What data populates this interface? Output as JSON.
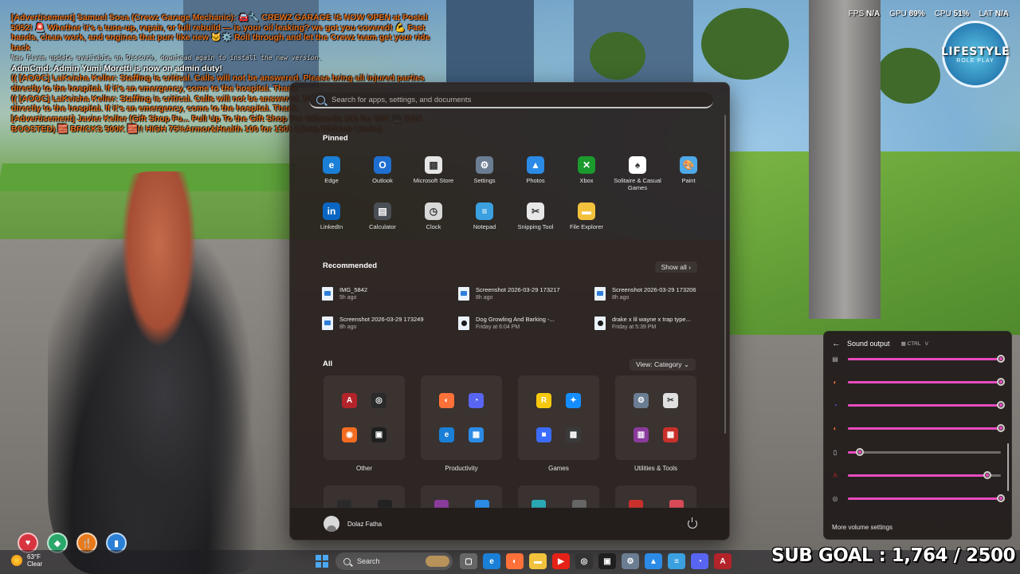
{
  "chat": [
    {
      "cls": "orange",
      "text": "[Advertisement] Samuel Sosa (Crewz Garage Mechanic): 🚘🔧 CREWZ GARAGE IS NOW OPEN at Postal 5052! 🚨 Whether it's a tune-up, repair, or full rebuild — is your oil leaking? we got you covered! 💪 Fast hands, clean work, and engines that purr like new 🐱⚙️ Roll through and let the Crewz team get your ride back"
    },
    {
      "cls": "small",
      "text": "New Fivem update available on Discord, download again to install the new version."
    },
    {
      "cls": "white",
      "text": "AdmCmd: Admin Yumi Moretti is now on admin duty!"
    },
    {
      "cls": "orange",
      "text": "(( [AOOC] LaKeisha Keller: Staffing is critical. Calls will not be answered. Please bring all injured parties directly to the hospital. If it's an emergency, come to the hospital. Thank"
    },
    {
      "cls": "orange",
      "text": "(( [AOOC] LaKeisha Keller: Staffing is critical. Calls will not be answered. Please bring all injured parties directly to the hospital. If it's an emergency, come to the hospital. Thank"
    },
    {
      "cls": "orange",
      "text": "[Advertisement] Javier Keller (Gift Shop Fu... Pull Up To the Gift Shop For Giftcards 100 for 50K 💻 (10X BOOSTED) 🧱 BRICKS 500K 🧱!! HIGH 75%Armor&Health 100 for 150k (Shop Without Limits)"
    }
  ],
  "hud": {
    "fps_label": "FPS",
    "fps_value": "N/A",
    "gpu_label": "GPU",
    "gpu_value": "89%",
    "cpu_label": "CPU",
    "cpu_value": "51%",
    "lat_label": "LAT",
    "lat_value": "N/A"
  },
  "logo": {
    "line1": "LIFESTYLE",
    "line2": "ROLE PLAY"
  },
  "start_menu": {
    "search_placeholder": "Search for apps, settings, and documents",
    "pinned_title": "Pinned",
    "pinned": [
      {
        "name": "edge",
        "label": "Edge",
        "icon": "edge-icon",
        "color": "#1a7fd6",
        "glyph": "e"
      },
      {
        "name": "outlook",
        "label": "Outlook",
        "icon": "outlook-icon",
        "color": "#1f6fd1",
        "glyph": "O"
      },
      {
        "name": "microsoft-store",
        "label": "Microsoft Store",
        "icon": "store-icon",
        "color": "#e6e6e6",
        "glyph": "▦"
      },
      {
        "name": "settings",
        "label": "Settings",
        "icon": "gear-icon",
        "color": "#6b7d92",
        "glyph": "⚙"
      },
      {
        "name": "photos",
        "label": "Photos",
        "icon": "photos-icon",
        "color": "#2b8be6",
        "glyph": "▲"
      },
      {
        "name": "xbox",
        "label": "Xbox",
        "icon": "xbox-icon",
        "color": "#1b9a2e",
        "glyph": "✕"
      },
      {
        "name": "solitaire",
        "label": "Solitaire & Casual Games",
        "icon": "cards-icon",
        "color": "#ffffff",
        "glyph": "♠"
      },
      {
        "name": "paint",
        "label": "Paint",
        "icon": "paint-icon",
        "color": "#4ea9e8",
        "glyph": "🎨"
      },
      {
        "name": "linkedin",
        "label": "LinkedIn",
        "icon": "linkedin-icon",
        "color": "#0a66c2",
        "glyph": "in"
      },
      {
        "name": "calculator",
        "label": "Calculator",
        "icon": "calculator-icon",
        "color": "#4a4e55",
        "glyph": "▤"
      },
      {
        "name": "clock",
        "label": "Clock",
        "icon": "clock-icon",
        "color": "#d8d8d8",
        "glyph": "◷"
      },
      {
        "name": "notepad",
        "label": "Notepad",
        "icon": "notepad-icon",
        "color": "#3aa0e0",
        "glyph": "≡"
      },
      {
        "name": "snipping-tool",
        "label": "Snipping Tool",
        "icon": "scissors-icon",
        "color": "#e8e8e8",
        "glyph": "✂"
      },
      {
        "name": "file-explorer",
        "label": "File Explorer",
        "icon": "folder-icon",
        "color": "#f2c23c",
        "glyph": "▬"
      }
    ],
    "recommended_title": "Recommended",
    "show_all": "Show all",
    "recommended": [
      {
        "title": "IMG_5842",
        "sub": "5h ago",
        "type": "img"
      },
      {
        "title": "Screenshot 2026-03-29 173217",
        "sub": "8h ago",
        "type": "img"
      },
      {
        "title": "Screenshot 2026-03-29 173206",
        "sub": "8h ago",
        "type": "img"
      },
      {
        "title": "Screenshot 2026-03-29 173249",
        "sub": "8h ago",
        "type": "img"
      },
      {
        "title": "Dog Growling And Barking -...",
        "sub": "Friday at 6:04 PM",
        "type": "doc"
      },
      {
        "title": "drake x lil wayne x trap type...",
        "sub": "Friday at 5:39 PM",
        "type": "doc"
      }
    ],
    "all_title": "All",
    "view_label": "View: Category",
    "categories": [
      {
        "label": "Other",
        "apps": [
          {
            "icon": "acrobat-icon",
            "color": "#b3232a",
            "glyph": "A"
          },
          {
            "icon": "obs-icon",
            "color": "#2a2a2a",
            "glyph": "◎"
          },
          {
            "icon": "origin-icon",
            "color": "#f36c21",
            "glyph": "◉"
          },
          {
            "icon": "capcut-icon",
            "color": "#1f1f1f",
            "glyph": "▣"
          }
        ]
      },
      {
        "label": "Productivity",
        "apps": [
          {
            "icon": "firefox-icon",
            "color": "#ff7139",
            "glyph": "◐"
          },
          {
            "icon": "discord-icon",
            "color": "#5865f2",
            "glyph": "◔"
          },
          {
            "icon": "edge-icon",
            "color": "#1a7fd6",
            "glyph": "e"
          },
          {
            "icon": "office-icon",
            "color": "#2b8be6",
            "glyph": "▦"
          }
        ]
      },
      {
        "label": "Games",
        "apps": [
          {
            "icon": "rockstar-icon",
            "color": "#f6c90e",
            "glyph": "R"
          },
          {
            "icon": "battlenet-icon",
            "color": "#148eff",
            "glyph": "✦"
          },
          {
            "icon": "roblox-icon",
            "color": "#3b6cff",
            "glyph": "■"
          },
          {
            "icon": "gamebar-icon",
            "color": "#3a3a3a",
            "glyph": "▩"
          }
        ]
      },
      {
        "label": "Utilities & Tools",
        "apps": [
          {
            "icon": "gear-icon",
            "color": "#6b7d92",
            "glyph": "⚙"
          },
          {
            "icon": "snipping-icon",
            "color": "#e0e0e0",
            "glyph": "✂"
          },
          {
            "icon": "winrar-icon",
            "color": "#8a3b9c",
            "glyph": "▥"
          },
          {
            "icon": "tools-icon",
            "color": "#c9302c",
            "glyph": "▦"
          }
        ]
      }
    ],
    "user_name": "Dolaz Fatha"
  },
  "sound": {
    "title": "Sound output",
    "shortcut_ctrl": "CTRL",
    "shortcut_v": "V",
    "rows": [
      {
        "icon": "speaker-icon",
        "color": "#bbbbbb",
        "glyph": "▤",
        "level": 1.0
      },
      {
        "icon": "firefox-icon",
        "color": "#ff7139",
        "glyph": "◐",
        "level": 1.0
      },
      {
        "icon": "discord-icon",
        "color": "#5865f2",
        "glyph": "◔",
        "level": 1.0
      },
      {
        "icon": "firefox-icon",
        "color": "#ff7139",
        "glyph": "◐",
        "level": 1.0
      },
      {
        "icon": "file-icon",
        "color": "#dddddd",
        "glyph": "▯",
        "level": 0.08
      },
      {
        "icon": "acrobat-icon",
        "color": "#b3232a",
        "glyph": "A",
        "level": 0.91
      },
      {
        "icon": "obs-icon",
        "color": "#bbbbbb",
        "glyph": "◎",
        "level": 1.0
      }
    ],
    "more": "More volume settings"
  },
  "weather": {
    "temp": "63°F",
    "cond": "Clear"
  },
  "taskbar": {
    "search_label": "Search",
    "icons": [
      {
        "icon": "task-view-icon",
        "color": "#666",
        "glyph": "▢"
      },
      {
        "icon": "edge-icon",
        "color": "#1a7fd6",
        "glyph": "e"
      },
      {
        "icon": "firefox-icon",
        "color": "#ff7139",
        "glyph": "◐"
      },
      {
        "icon": "folder-icon",
        "color": "#f2c23c",
        "glyph": "▬"
      },
      {
        "icon": "youtube-icon",
        "color": "#e62117",
        "glyph": "▶"
      },
      {
        "icon": "obs-icon",
        "color": "#333",
        "glyph": "◎"
      },
      {
        "icon": "capcut-icon",
        "color": "#1f1f1f",
        "glyph": "▣"
      },
      {
        "icon": "gear-icon",
        "color": "#6b7d92",
        "glyph": "⚙"
      },
      {
        "icon": "photos-icon",
        "color": "#2b8be6",
        "glyph": "▲"
      },
      {
        "icon": "notepad-icon",
        "color": "#3aa0e0",
        "glyph": "≡"
      },
      {
        "icon": "discord-icon",
        "color": "#5865f2",
        "glyph": "◔"
      },
      {
        "icon": "acrobat-icon",
        "color": "#b3232a",
        "glyph": "A"
      }
    ]
  },
  "sub_goal": "SUB GOAL : 1,764 / 2500",
  "hud_circles": [
    {
      "icon": "heart-icon",
      "color": "#d8343f",
      "glyph": "♥"
    },
    {
      "icon": "armor-icon",
      "color": "#2aa86b",
      "glyph": "◆"
    },
    {
      "icon": "hunger-icon",
      "color": "#e87a1c",
      "glyph": "🍴"
    },
    {
      "icon": "thirst-icon",
      "color": "#2b7fd6",
      "glyph": "▮"
    }
  ]
}
